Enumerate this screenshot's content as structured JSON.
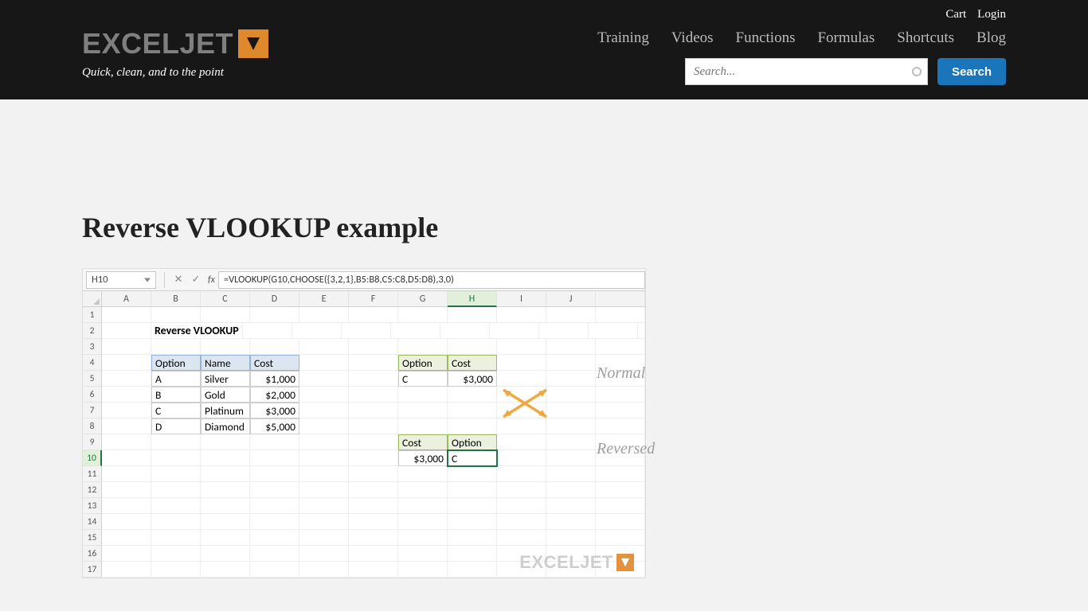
{
  "util": {
    "cart": "Cart",
    "login": "Login"
  },
  "brand": {
    "name": "EXCELJET",
    "tagline": "Quick, clean, and to the point"
  },
  "nav": {
    "items": [
      "Training",
      "Videos",
      "Functions",
      "Formulas",
      "Shortcuts",
      "Blog"
    ]
  },
  "search": {
    "placeholder": "Search...",
    "button": "Search"
  },
  "page": {
    "title": "Reverse VLOOKUP example"
  },
  "excel": {
    "name_box": "H10",
    "formula": "=VLOOKUP(G10,CHOOSE({3,2,1},B5:B8,C5:C8,D5:D8),3,0)",
    "columns": [
      "A",
      "B",
      "C",
      "D",
      "E",
      "F",
      "G",
      "H",
      "I",
      "J"
    ],
    "selected_col": "H",
    "row_count": 17,
    "selected_row": 10,
    "sheet_title": "Reverse VLOOKUP",
    "table_main": {
      "headers": [
        "Option",
        "Name",
        "Cost"
      ],
      "rows": [
        [
          "A",
          "Silver",
          "$1,000"
        ],
        [
          "B",
          "Gold",
          "$2,000"
        ],
        [
          "C",
          "Platinum",
          "$3,000"
        ],
        [
          "D",
          "Diamond",
          "$5,000"
        ]
      ]
    },
    "table_normal": {
      "headers": [
        "Option",
        "Cost"
      ],
      "row": [
        "C",
        "$3,000"
      ]
    },
    "table_reversed": {
      "headers": [
        "Cost",
        "Option"
      ],
      "row": [
        "$3,000",
        "C"
      ]
    },
    "annotations": {
      "normal": "Normal",
      "reversed": "Reversed"
    },
    "watermark": "EXCELJET"
  }
}
